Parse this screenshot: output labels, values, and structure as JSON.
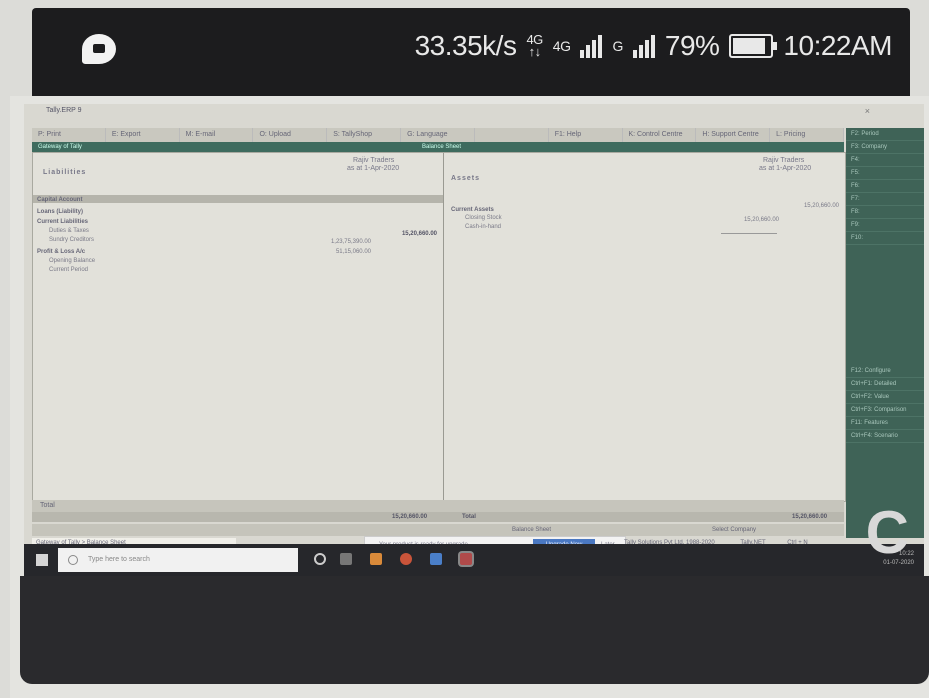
{
  "status_bar": {
    "speed": "33.35k/s",
    "net_top": "4G",
    "net_bottom": "↑↓",
    "net1": "4G",
    "net2": "G",
    "battery": "79%",
    "time": "10:22AM"
  },
  "window": {
    "title": "Tally.ERP 9",
    "close": "×",
    "menu": [
      "P: Print",
      "E: Export",
      "M: E-mail",
      "O: Upload",
      "S: TallyShop",
      "G: Language",
      "",
      "F1: Help",
      "K: Control Centre",
      "H: Support Centre",
      "L: Pricing"
    ],
    "company_label": "Gateway of Tally",
    "report_title": "Balance Sheet"
  },
  "report": {
    "left_header": "Liabilities",
    "left_company": "Rajiv Traders",
    "left_period": "as at 1-Apr-2020",
    "right_header": "Assets",
    "right_company": "Rajiv Traders",
    "right_period": "as at 1-Apr-2020",
    "liabilities": [
      {
        "label": "Capital Account",
        "head": true
      },
      {
        "label": "Loans (Liability)",
        "head": true
      },
      {
        "label": "Current Liabilities",
        "head": true
      },
      {
        "label": "Duties & Taxes",
        "head": false
      },
      {
        "label": "Sundry Creditors",
        "head": false
      },
      {
        "label": "Profit & Loss A/c",
        "head": true
      },
      {
        "label": "Opening Balance",
        "head": false
      },
      {
        "label": "Current Period",
        "head": false
      }
    ],
    "liab_amounts": {
      "current_liabilities": "15,20,660.00",
      "sundry_creditors": "1,23,75,390.00",
      "pl_sub": "51,15,060.00"
    },
    "assets": [
      {
        "label": "Current Assets",
        "head": true
      },
      {
        "label": "Closing Stock",
        "head": false
      },
      {
        "label": "Cash-in-hand",
        "head": false
      }
    ],
    "asset_amounts": {
      "current_assets": "15,20,660.00",
      "closing_stock": "15,20,660.00"
    },
    "total_label": "Total",
    "total_left": "15,20,660.00",
    "total_right_label": "Total",
    "total_right": "15,20,660.00"
  },
  "side_panel": [
    "F2: Period",
    "F3: Company",
    "F4:",
    "F5:",
    "F6:",
    "F7:",
    "F8:",
    "F9:",
    "F10:",
    "F12: Configure",
    "Ctrl+F1: Detailed",
    "Ctrl+F2: Value",
    "Ctrl+F3: Comparison",
    "F11: Features",
    "Ctrl+F4: Scenario"
  ],
  "bottom": {
    "breadcrumb": "Gateway of Tally > Balance Sheet",
    "strip_center": "Balance Sheet",
    "strip_right": "Select Company",
    "notice_text": "Your product is ready for upgrade",
    "notice_button": "Upgrade Now",
    "notice_later": "Later",
    "info1": "Tally Solutions Pvt Ltd, 1988-2020",
    "info2": "Tally.NET",
    "info3": "Ctrl + N"
  },
  "taskbar": {
    "search_placeholder": "Type here to search",
    "tray_time": "10:22",
    "tray_date": "01-07-2020"
  },
  "corner_mark": "C"
}
